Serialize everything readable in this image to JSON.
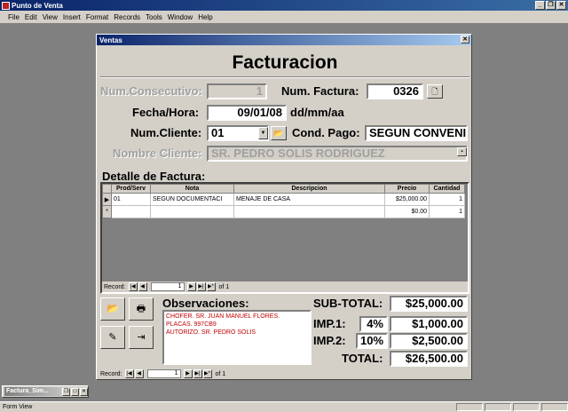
{
  "app": {
    "title": "Punto de Venta",
    "window_buttons": [
      "_",
      "❐",
      "✕"
    ]
  },
  "menu": [
    "File",
    "Edit",
    "View",
    "Insert",
    "Format",
    "Records",
    "Tools",
    "Window",
    "Help"
  ],
  "form": {
    "window_title": "Ventas",
    "heading": "Facturacion",
    "num_consecutivo_label": "Num.Consecutivo:",
    "num_consecutivo_value": "1",
    "num_factura_label": "Num. Factura:",
    "num_factura_value": "0326",
    "fecha_label": "Fecha/Hora:",
    "fecha_value": "09/01/08",
    "fecha_format": "dd/mm/aa",
    "num_cliente_label": "Num.Cliente:",
    "num_cliente_value": "01",
    "cond_pago_label": "Cond. Pago:",
    "cond_pago_value": "SEGUN CONVENI",
    "nombre_cliente_label": "Nombre Cliente:",
    "nombre_cliente_value": "SR. PEDRO SOLIS RODRIGUEZ",
    "detalle_label": "Detalle de Factura:"
  },
  "detail_grid": {
    "columns": [
      "Prod/Serv",
      "Nota",
      "Descripcion",
      "Precio",
      "Cantidad"
    ],
    "rows": [
      {
        "selector": "▶",
        "prod": "01",
        "nota": "SEGUN DOCUMENTACI",
        "descripcion": "MENAJE DE CASA",
        "precio": "$25,000.00",
        "cantidad": "1"
      },
      {
        "selector": "*",
        "prod": "",
        "nota": "",
        "descripcion": "",
        "precio": "$0.00",
        "cantidad": "1"
      }
    ],
    "nav": {
      "label": "Record:",
      "current": "1",
      "of_text": "of 1"
    }
  },
  "observaciones": {
    "label": "Observaciones:",
    "lines": [
      "CHOFER. SR. JUAN MANUEL FLORES.",
      "PLACAS. 997CB9",
      "AUTORIZO. SR. PEDRO SOLIS"
    ]
  },
  "totals": {
    "subtotal_label": "SUB-TOTAL:",
    "subtotal_value": "$25,000.00",
    "imp1_label": "IMP.1:",
    "imp1_rate": "4%",
    "imp1_value": "$1,000.00",
    "imp2_label": "IMP.2:",
    "imp2_rate": "10%",
    "imp2_value": "$2,500.00",
    "total_label": "TOTAL:",
    "total_value": "$26,500.00"
  },
  "form_nav": {
    "label": "Record:",
    "current": "1",
    "of_text": "of 1"
  },
  "minimized_window": {
    "title": "Factura_Sim..."
  },
  "status": {
    "text": "Form View"
  },
  "icons": {
    "open_folder": "folder-icon",
    "print": "printer-icon",
    "edit": "edit-icon",
    "exit": "exit-icon",
    "preview": "preview-icon"
  }
}
